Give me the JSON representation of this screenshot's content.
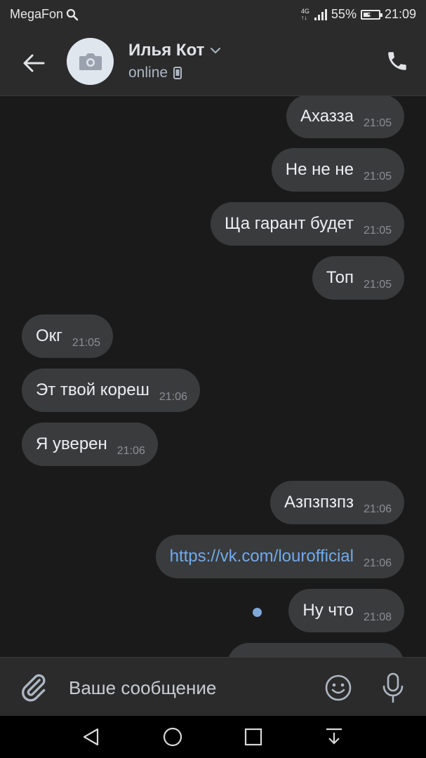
{
  "status_bar": {
    "carrier": "MegaFon",
    "network_top": "4G",
    "network_bottom": "↑↓",
    "battery_percent": "55%",
    "battery_level": 0.55,
    "time": "21:09"
  },
  "header": {
    "contact_name": "Илья Кот",
    "status": "online"
  },
  "messages": [
    {
      "direction": "out",
      "text": "Ахазза",
      "time": "21:05"
    },
    {
      "direction": "out",
      "text": "Не не не",
      "time": "21:05"
    },
    {
      "direction": "out",
      "text": "Ща гарант будет",
      "time": "21:05"
    },
    {
      "direction": "out",
      "text": "Топ",
      "time": "21:05"
    },
    {
      "direction": "in",
      "text": "Окг",
      "time": "21:05"
    },
    {
      "direction": "in",
      "text": "Эт твой кореш",
      "time": "21:06"
    },
    {
      "direction": "in",
      "text": "Я уверен",
      "time": "21:06"
    },
    {
      "direction": "out",
      "text": "Азпзпзпз",
      "time": "21:06"
    },
    {
      "direction": "out",
      "text": "https://vk.com/lourofficial",
      "time": "21:06",
      "link": true
    },
    {
      "direction": "out",
      "text": "Ну что",
      "time": "21:08",
      "unread": true
    }
  ],
  "composer": {
    "placeholder": "Ваше сообщение"
  },
  "colors": {
    "background": "#1a1a1a",
    "bar": "#2b2b2c",
    "bubble": "#3a3b3c",
    "link": "#71aaeb",
    "unread_dot": "#7fa8d8"
  }
}
